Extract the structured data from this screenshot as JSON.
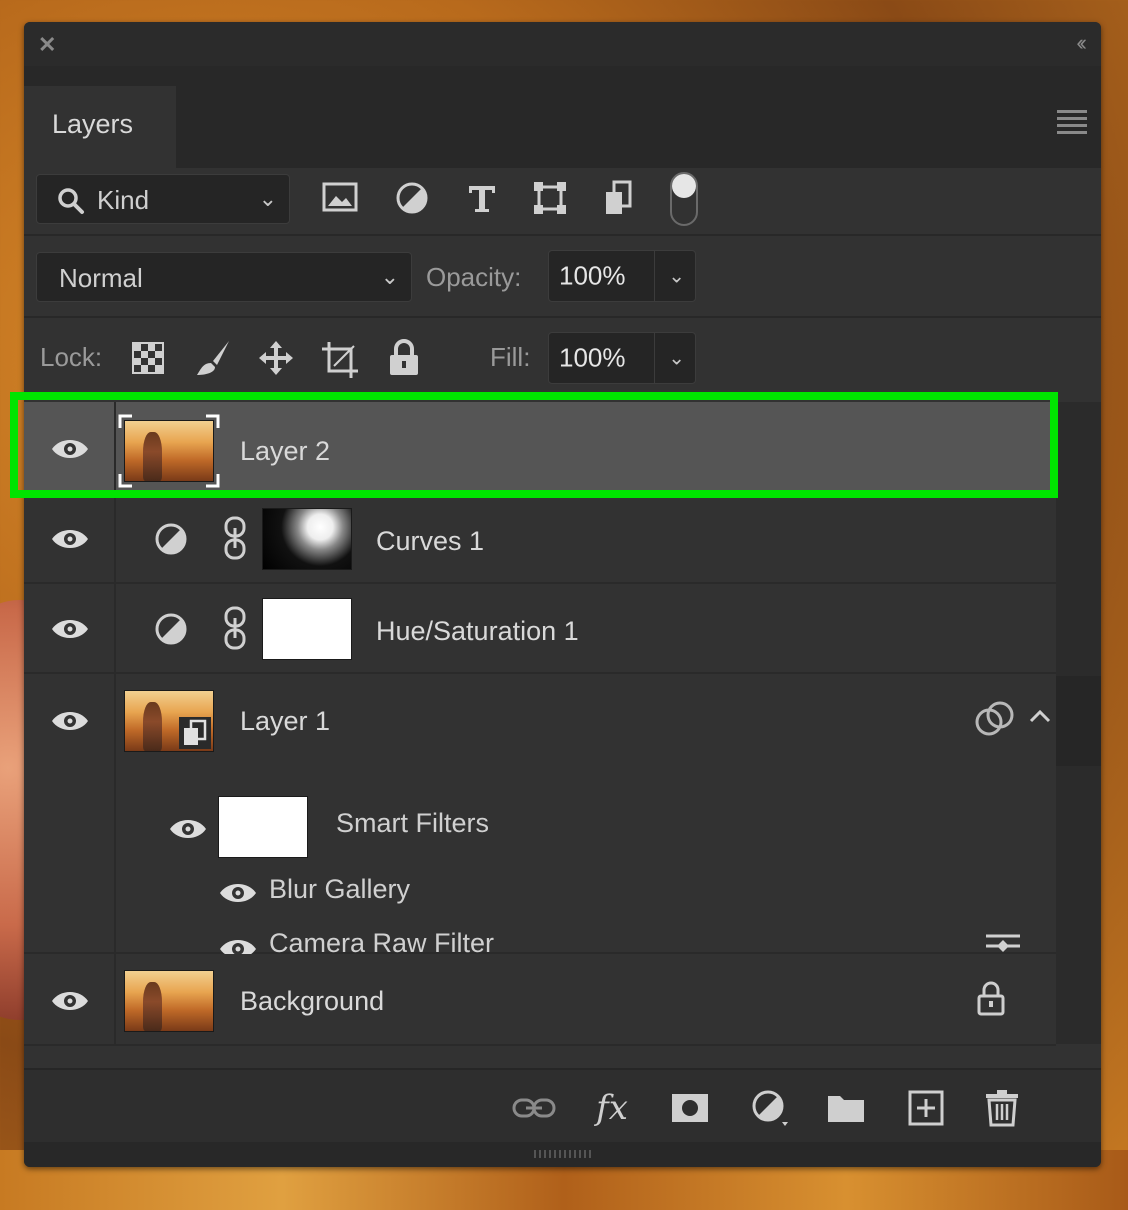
{
  "panel": {
    "tab_label": "Layers"
  },
  "filter": {
    "kind_label": "Kind",
    "icons": [
      "image-filter-icon",
      "adjustment-filter-icon",
      "type-filter-icon",
      "shape-filter-icon",
      "smart-object-filter-icon",
      "filter-toggle-icon"
    ]
  },
  "blend": {
    "mode": "Normal",
    "opacity_label": "Opacity:",
    "opacity_value": "100%"
  },
  "lock": {
    "label": "Lock:",
    "icons": [
      "lock-transparent-pixels-icon",
      "lock-image-pixels-icon",
      "lock-position-icon",
      "lock-artboard-icon",
      "lock-all-icon"
    ],
    "fill_label": "Fill:",
    "fill_value": "100%"
  },
  "layers": [
    {
      "name": "Layer 2",
      "selected": true,
      "type": "pixel"
    },
    {
      "name": "Curves 1",
      "type": "adjustment-clipped"
    },
    {
      "name": "Hue/Saturation 1",
      "type": "adjustment-clipped"
    },
    {
      "name": "Layer 1",
      "type": "smart-object"
    },
    {
      "name": "Background",
      "type": "background",
      "locked": true
    }
  ],
  "smart_filters": {
    "label": "Smart Filters",
    "items": [
      "Blur Gallery",
      "Camera Raw Filter"
    ]
  },
  "bottom_toolbar": {
    "icons": [
      "link-layers-icon",
      "fx-icon",
      "add-mask-icon",
      "new-adjustment-icon",
      "new-group-icon",
      "new-layer-icon",
      "delete-layer-icon"
    ],
    "fx_label": "fx"
  },
  "colors": {
    "panel_bg": "#323232",
    "selected_row": "#555555",
    "highlight_outline": "#00e400"
  }
}
